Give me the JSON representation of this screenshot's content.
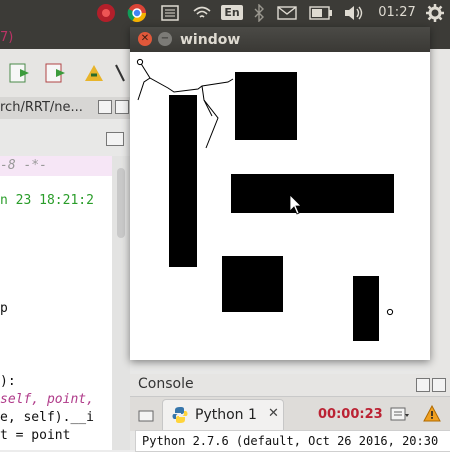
{
  "topbar": {
    "language": "En",
    "clock": "01:27"
  },
  "eclipse": {
    "menu_fragment": "7)",
    "path_text": "rch/RRT/ne...",
    "code_lines": [
      "-8 -*-",
      "n 23 18:21:2",
      "p",
      "):",
      "self, point,",
      "e, self).__i",
      "t = point"
    ]
  },
  "console": {
    "title": "Console",
    "tab_label": "Python 1",
    "tab_close": "✕",
    "timer": "00:00:23",
    "output": "Python 2.7.6 (default, Oct 26 2016, 20:30"
  },
  "window": {
    "title": "window",
    "close_symbol": "✕",
    "minimize_symbol": "−"
  },
  "colors": {
    "panel": "#3c3b37",
    "close_button": "#e0583a",
    "obstacle": "#000000",
    "tree_line": "#000000"
  }
}
